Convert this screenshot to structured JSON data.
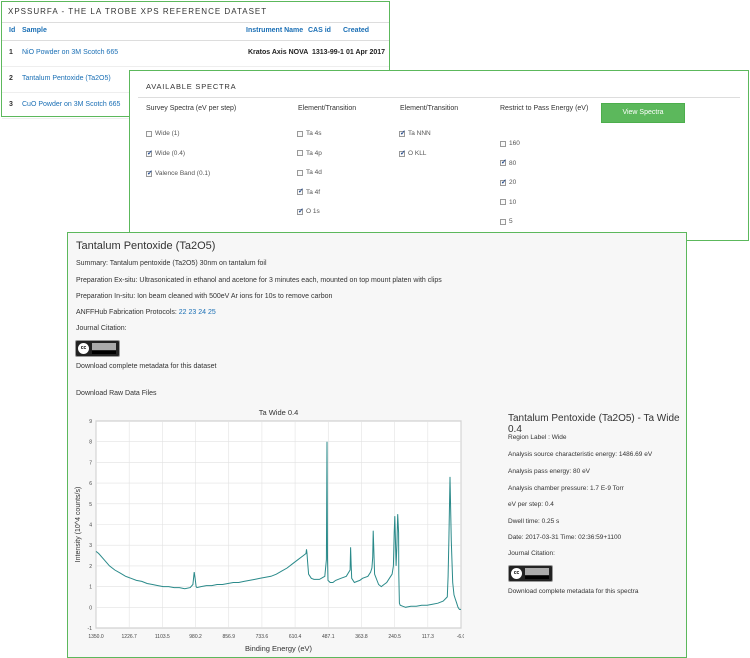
{
  "panel1": {
    "header": "XPSSURFA - THE LA TROBE XPS REFERENCE DATASET",
    "columns": {
      "id": "Id",
      "sample": "Sample",
      "instrument": "Instrument Name",
      "cas": "CAS id",
      "created": "Created"
    },
    "rows": [
      {
        "id": "1",
        "sample": "NiO Powder on 3M Scotch 665",
        "instrument": "Kratos Axis NOVA",
        "cas": "1313-99-1",
        "created": "01 Apr 2017"
      },
      {
        "id": "2",
        "sample": "Tantalum Pentoxide (Ta2O5)",
        "instrument": "",
        "cas": "",
        "created": ""
      },
      {
        "id": "3",
        "sample": "CuO Powder on 3M Scotch 665",
        "instrument": "",
        "cas": "",
        "created": ""
      }
    ]
  },
  "panel2": {
    "header": "AVAILABLE SPECTRA",
    "col_survey": "Survey Spectra (eV per step)",
    "col_elem1": "Element/Transition",
    "col_elem2": "Element/Transition",
    "col_pass": "Restrict to Pass Energy (eV)",
    "survey": [
      {
        "label": "Wide (1)",
        "checked": false
      },
      {
        "label": "Wide (0.4)",
        "checked": true
      },
      {
        "label": "Valence Band (0.1)",
        "checked": true
      }
    ],
    "elem1": [
      {
        "label": "Ta 4s",
        "checked": false
      },
      {
        "label": "Ta 4p",
        "checked": false
      },
      {
        "label": "Ta 4d",
        "checked": false
      },
      {
        "label": "Ta 4f",
        "checked": true
      },
      {
        "label": "O 1s",
        "checked": true
      }
    ],
    "elem2": [
      {
        "label": "Ta NNN",
        "checked": true
      },
      {
        "label": "O KLL",
        "checked": true
      }
    ],
    "pass": [
      {
        "label": "160",
        "checked": false
      },
      {
        "label": "80",
        "checked": true
      },
      {
        "label": "20",
        "checked": true
      },
      {
        "label": "10",
        "checked": false
      },
      {
        "label": "5",
        "checked": false
      }
    ],
    "view_button": "View Spectra"
  },
  "panel3": {
    "title": "Tantalum Pentoxide (Ta2O5)",
    "summary": "Summary: Tantalum pentoxide (Ta2O5) 30nm on tantalum foil",
    "prep_ex": "Preparation Ex-situ: Ultrasonicated in ethanol and acetone for 3 minutes each, mounted on top mount platen with clips",
    "prep_in": "Preparation In-situ: Ion beam cleaned with 500eV Ar ions for 10s to remove carbon",
    "anff_label": "ANFFHub Fabrication Protocols:",
    "anff_links": [
      "22",
      "23",
      "24",
      "25"
    ],
    "journal": "Journal Citation:",
    "download_meta": "Download complete metadata for this dataset",
    "download_raw": "Download Raw Data Files",
    "cc_badge": "cc",
    "side": {
      "title": "Tantalum Pentoxide (Ta2O5) - Ta Wide 0.4",
      "region": "Region Label : Wide",
      "source": "Analysis source characteristic energy: 1486.69 eV",
      "pass": "Analysis pass energy: 80 eV",
      "pressure": "Analysis chamber pressure: 1.7 E-9 Torr",
      "step": "eV per step: 0.4",
      "dwell": "Dwell time: 0.25 s",
      "date": "Date: 2017-03-31 Time: 02:36:59+1100",
      "journal": "Journal Citation:",
      "download": "Download complete metadata for this spectra"
    }
  },
  "chart_data": {
    "type": "line",
    "title": "Ta Wide 0.4",
    "xlabel": "Binding Energy (eV)",
    "ylabel": "Intensity (10^4 counts/s)",
    "xlim": [
      1350.0,
      -6.0
    ],
    "ylim": [
      -1,
      9
    ],
    "xticks": [
      "1350.0",
      "1226.7",
      "1103.5",
      "980.2",
      "856.9",
      "733.6",
      "610.4",
      "487.1",
      "363.8",
      "240.5",
      "117.3",
      "-6.0"
    ],
    "yticks": [
      "-1",
      "0",
      "1",
      "2",
      "3",
      "4",
      "5",
      "6",
      "7",
      "8",
      "9"
    ],
    "grid": true,
    "line_color": "#2a8a8a",
    "series": [
      {
        "x": [
          1350,
          1340,
          1320,
          1300,
          1280,
          1260,
          1240,
          1220,
          1200,
          1180,
          1160,
          1140,
          1120,
          1100,
          1080,
          1060,
          1040,
          1020,
          1000,
          990,
          985,
          982,
          978,
          975,
          960,
          940,
          920,
          900,
          880,
          860,
          840,
          820,
          800,
          780,
          760,
          740,
          720,
          700,
          680,
          660,
          640,
          620,
          600,
          580,
          570,
          568,
          566,
          564,
          560,
          550,
          540,
          520,
          500,
          494,
          492,
          490,
          488,
          480,
          470,
          460,
          440,
          420,
          406,
          404,
          402,
          400,
          390,
          380,
          370,
          360,
          340,
          330,
          325,
          322,
          320,
          315,
          300,
          290,
          280,
          270,
          260,
          250,
          245,
          242,
          240,
          238,
          235,
          232,
          229,
          226,
          225,
          223,
          220,
          210,
          200,
          180,
          160,
          140,
          120,
          100,
          80,
          60,
          45,
          42,
          39,
          35,
          30,
          25,
          20,
          15,
          10,
          5,
          0,
          -6
        ],
        "y": [
          2.7,
          2.6,
          2.3,
          2.0,
          1.8,
          1.65,
          1.5,
          1.4,
          1.3,
          1.25,
          1.15,
          1.1,
          1.05,
          1.0,
          1.0,
          0.95,
          0.95,
          0.9,
          0.95,
          1.1,
          1.7,
          1.4,
          1.0,
          0.95,
          1.0,
          1.05,
          1.05,
          1.1,
          1.1,
          1.15,
          1.2,
          1.2,
          1.25,
          1.3,
          1.35,
          1.4,
          1.45,
          1.5,
          1.6,
          1.75,
          1.9,
          2.1,
          2.3,
          2.5,
          2.6,
          2.8,
          2.6,
          2.2,
          1.6,
          1.4,
          1.35,
          1.35,
          1.5,
          2.3,
          8.0,
          2.4,
          1.3,
          1.2,
          1.2,
          1.3,
          1.4,
          1.5,
          1.8,
          2.9,
          2.0,
          1.4,
          1.2,
          1.25,
          1.3,
          1.4,
          1.5,
          1.7,
          1.9,
          2.4,
          3.7,
          1.6,
          1.1,
          1.0,
          1.1,
          1.2,
          1.4,
          1.6,
          2.0,
          3.6,
          4.4,
          3.5,
          2.0,
          3.0,
          4.5,
          3.6,
          1.6,
          0.2,
          0.1,
          0.05,
          0.0,
          0.05,
          0.05,
          0.1,
          0.1,
          0.15,
          0.2,
          0.3,
          0.5,
          1.5,
          3.3,
          6.3,
          3.2,
          1.2,
          0.6,
          0.4,
          0.2,
          0.0,
          -0.1,
          -0.1
        ]
      }
    ]
  }
}
